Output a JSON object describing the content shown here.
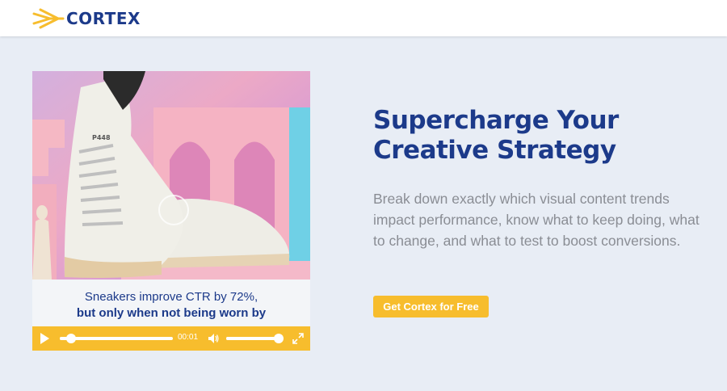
{
  "header": {
    "logo_text": "CORTEX"
  },
  "video": {
    "caption_line1": "Sneakers improve CTR by 72%,",
    "caption_line2": "but only when not being worn by",
    "current_time": "00:01",
    "progress_fraction": 0.1,
    "volume_fraction": 0.95,
    "shoe_brand": "P448"
  },
  "hero": {
    "headline_line1": "Supercharge Your",
    "headline_line2": "Creative Strategy",
    "description": "Break down exactly which visual content trends impact performance, know what to keep doing, what to change, and what to test to boost conversions.",
    "cta_label": "Get Cortex for Free"
  },
  "colors": {
    "brand_blue": "#1c3a8a",
    "accent_yellow": "#f7bd2d",
    "background": "#e8edf5",
    "body_text": "#8a8d94"
  },
  "icons": [
    "cortex-logo-icon",
    "play-icon",
    "volume-icon",
    "fullscreen-icon"
  ]
}
